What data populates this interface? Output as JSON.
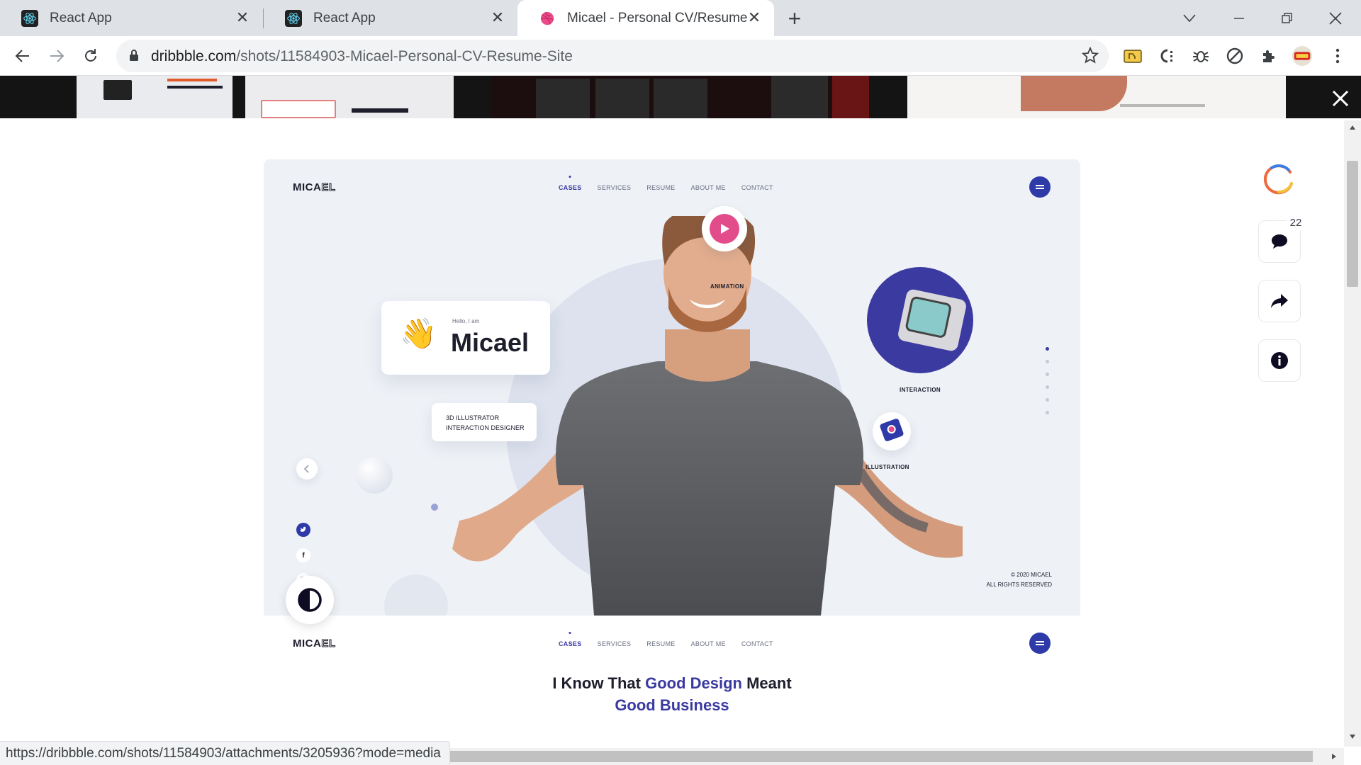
{
  "tabs": [
    {
      "title": "React App",
      "icon": "react-icon"
    },
    {
      "title": "React App",
      "icon": "react-icon"
    },
    {
      "title": "Micael - Personal CV/Resume Site",
      "icon": "dribbble-icon"
    }
  ],
  "address_bar": {
    "domain": "dribbble.com",
    "path": "/shots/11584903-Micael-Personal-CV-Resume-Site"
  },
  "shot": {
    "logo": "MICA",
    "logo_ghost": "EL",
    "nav": [
      "CASES",
      "SERVICES",
      "RESUME",
      "ABOUT ME",
      "CONTACT"
    ],
    "hello": "Hello, I am",
    "name": "Micael",
    "role_line1": "3D ILLUSTRATOR",
    "role_line2": "INTERACTION DESIGNER",
    "badges": {
      "animation": "ANIMATION",
      "interaction": "INTERACTION",
      "illustration": "ILLUSTRATION"
    },
    "copyright_line1": "© 2020 MICAEL",
    "copyright_line2": "ALL RIGHTS RESERVED",
    "headline_part1": "I Know That ",
    "headline_accent1": "Good Design",
    "headline_part2": " Meant",
    "headline_accent2": "Good Business"
  },
  "side_actions": {
    "comment_count": "22"
  },
  "status_url": "https://dribbble.com/shots/11584903/attachments/3205936?mode=media",
  "colors": {
    "accent": "#3a3aa0",
    "dribbble_pink": "#ea4c89",
    "tab_bg": "#dee1e6"
  }
}
